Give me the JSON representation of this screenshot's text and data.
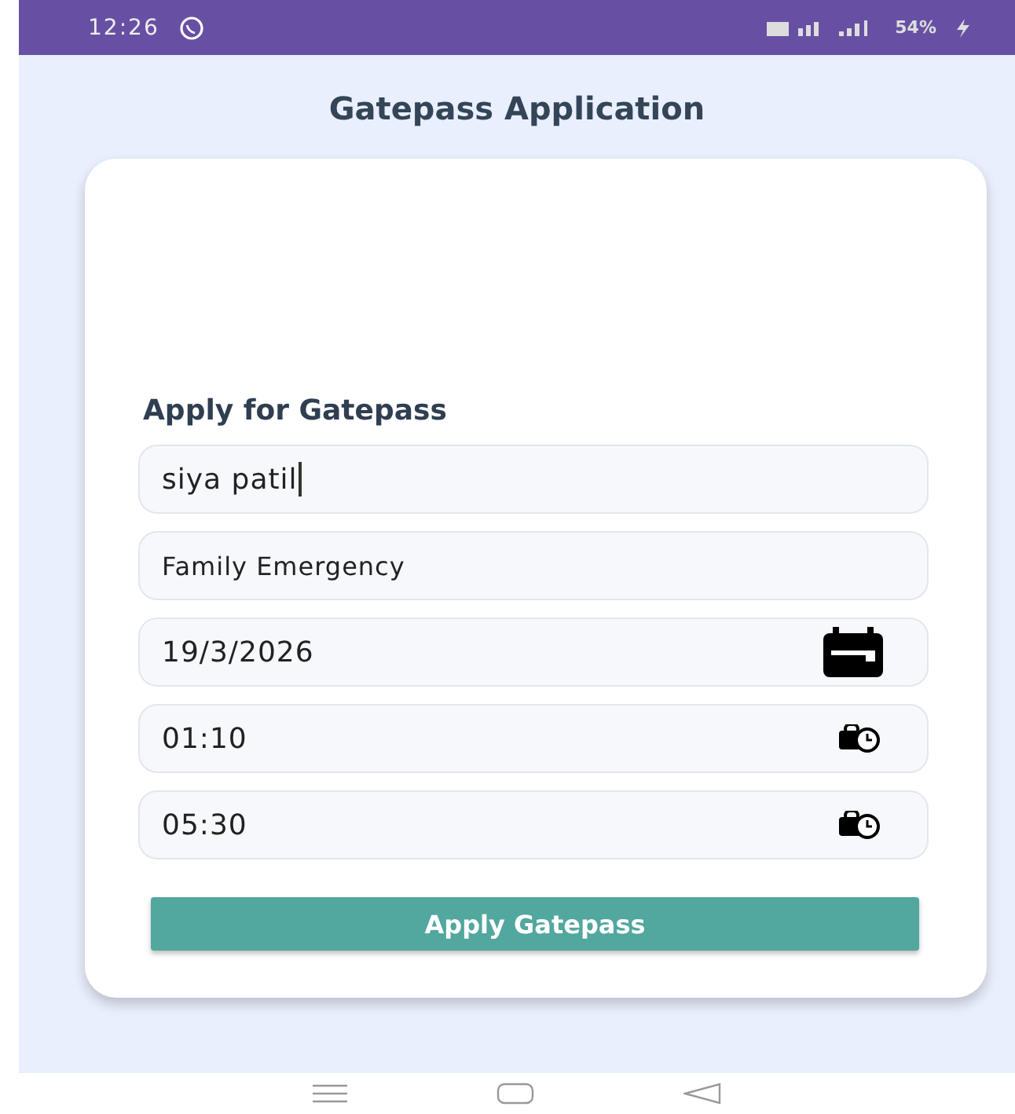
{
  "status_bar": {
    "time": "12:26",
    "battery": "54%"
  },
  "title": "Gatepass Application",
  "form": {
    "heading": "Apply for Gatepass",
    "fields": [
      {
        "kind": "text",
        "value": "siya patil",
        "focused": true
      },
      {
        "kind": "text",
        "value": "Family Emergency",
        "focused": false
      },
      {
        "kind": "date",
        "value": "19/3/2026",
        "focused": false
      },
      {
        "kind": "time",
        "value": "01:10",
        "focused": false
      },
      {
        "kind": "time",
        "value": "05:30",
        "focused": false
      }
    ],
    "button": "Apply Gatepass"
  }
}
